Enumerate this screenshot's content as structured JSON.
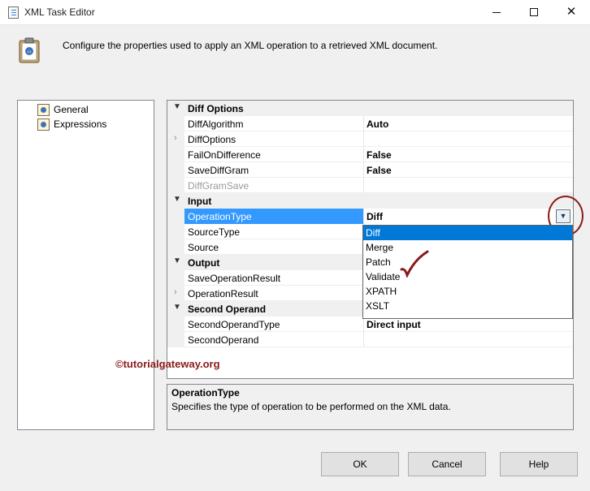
{
  "window": {
    "title": "XML Task Editor"
  },
  "header": {
    "description": "Configure the properties used to apply an XML operation to a retrieved XML document."
  },
  "nav": {
    "items": [
      {
        "label": "General"
      },
      {
        "label": "Expressions"
      }
    ]
  },
  "grid": {
    "diff_options": "Diff Options",
    "diff_algorithm": "DiffAlgorithm",
    "diff_algorithm_value": "Auto",
    "diff_options_prop": "DiffOptions",
    "fail_on_difference": "FailOnDifference",
    "fail_on_difference_value": "False",
    "save_diff_gram": "SaveDiffGram",
    "save_diff_gram_value": "False",
    "diff_gram_save": "DiffGramSave",
    "input": "Input",
    "operation_type": "OperationType",
    "operation_type_value": "Diff",
    "source_type": "SourceType",
    "source": "Source",
    "output": "Output",
    "save_operation_result": "SaveOperationResult",
    "operation_result": "OperationResult",
    "second_operand_cat": "Second Operand",
    "second_operand_type": "SecondOperandType",
    "second_operand_type_value": "Direct input",
    "second_operand": "SecondOperand"
  },
  "dropdown": {
    "options": [
      "Diff",
      "Merge",
      "Patch",
      "Validate",
      "XPATH",
      "XSLT"
    ],
    "selected": "Diff"
  },
  "watermark": "©tutorialgateway.org",
  "description_panel": {
    "title": "OperationType",
    "text": "Specifies the type of operation to be performed on the XML data."
  },
  "buttons": {
    "ok": "OK",
    "cancel": "Cancel",
    "help": "Help"
  },
  "colors": {
    "selection": "#3399ff",
    "dropdown_selection": "#0078d7",
    "annotation": "#8b1a1a"
  }
}
